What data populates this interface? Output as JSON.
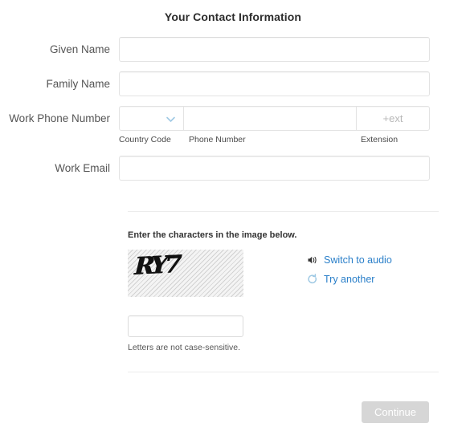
{
  "page": {
    "title": "Your Contact Information"
  },
  "form": {
    "fields": [
      {
        "label": "Given Name",
        "value": "",
        "placeholder": ""
      },
      {
        "label": "Family Name",
        "value": "",
        "placeholder": ""
      }
    ],
    "phone": {
      "label": "Work Phone Number",
      "country_code": {
        "value": "",
        "sublabel": "Country Code",
        "icon": "chevron-down-icon"
      },
      "number": {
        "value": "",
        "placeholder": "",
        "sublabel": "Phone Number"
      },
      "extension": {
        "value": "",
        "placeholder": "+ext",
        "sublabel": "Extension"
      }
    },
    "email": {
      "label": "Work Email",
      "value": "",
      "placeholder": ""
    }
  },
  "captcha": {
    "prompt": "Enter the characters in the image below.",
    "image_characters": "RY7",
    "answer_value": "",
    "answer_placeholder": "",
    "note": "Letters are not case-sensitive.",
    "links": [
      {
        "label": "Switch to audio",
        "icon": "speaker-icon"
      },
      {
        "label": "Try another",
        "icon": "refresh-icon"
      }
    ]
  },
  "footer": {
    "continue_label": "Continue",
    "continue_disabled": true
  },
  "colors": {
    "link": "#2a7fc9",
    "chevron": "#9fc9e4",
    "refresh_icon": "#9fc9e4",
    "button_disabled_bg": "#d6d6d6",
    "divider": "#ececec"
  }
}
